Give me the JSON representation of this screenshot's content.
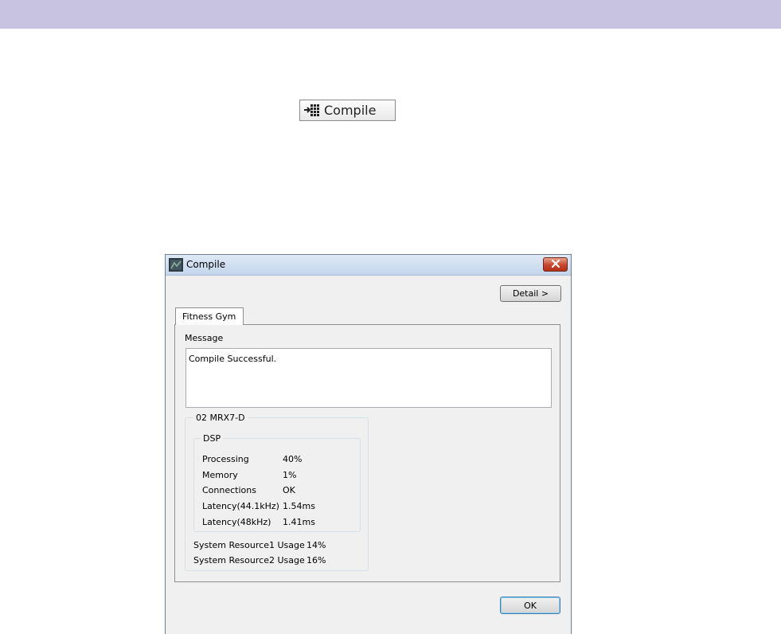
{
  "toolbar_button": {
    "label": "Compile",
    "icon": "compile-grid-icon"
  },
  "dialog": {
    "title": "Compile",
    "detail_button": "Detail >",
    "ok_button": "OK",
    "tab": "Fitness Gym",
    "message_label": "Message",
    "message_text": "Compile Successful.",
    "device": {
      "name": "02 MRX7-D",
      "dsp": {
        "label": "DSP",
        "rows": [
          {
            "label": "Processing",
            "value": "40%"
          },
          {
            "label": "Memory",
            "value": "1%"
          },
          {
            "label": "Connections",
            "value": "OK"
          },
          {
            "label": "Latency(44.1kHz)",
            "value": "1.54ms"
          },
          {
            "label": "Latency(48kHz)",
            "value": "1.41ms"
          }
        ]
      },
      "resources": [
        {
          "label": "System Resource1 Usage",
          "value": "14%"
        },
        {
          "label": "System Resource2 Usage",
          "value": "16%"
        }
      ]
    }
  },
  "colors": {
    "top_band": "#c8c3e0",
    "close_button": "#c8452b",
    "dialog_bg": "#f0f0f0"
  }
}
